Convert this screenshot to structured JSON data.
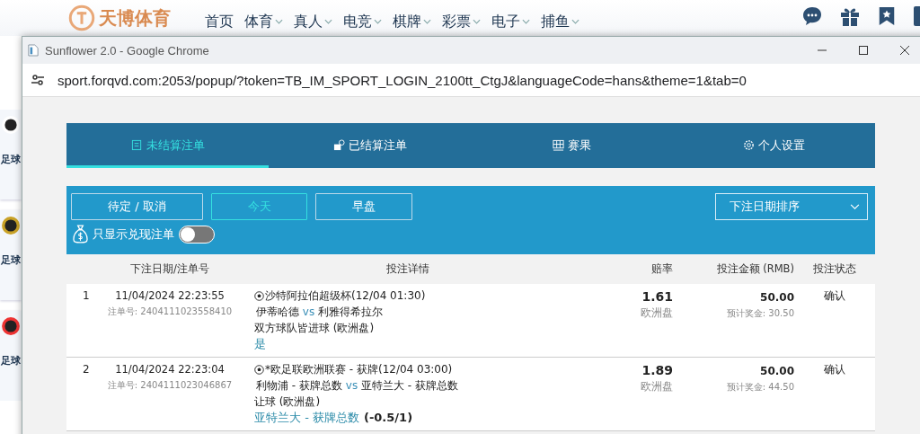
{
  "background_site": {
    "logo_text": "天博体育",
    "nav": [
      {
        "label": "首页",
        "dropdown": false
      },
      {
        "label": "体育",
        "dropdown": true
      },
      {
        "label": "真人",
        "dropdown": true
      },
      {
        "label": "电竞",
        "dropdown": true
      },
      {
        "label": "棋牌",
        "dropdown": true
      },
      {
        "label": "彩票",
        "dropdown": true
      },
      {
        "label": "电子",
        "dropdown": true
      },
      {
        "label": "捕鱼",
        "dropdown": true
      }
    ],
    "sidebar_cards": [
      {
        "title": "足球"
      },
      {
        "title": "足球"
      },
      {
        "title": "足球"
      }
    ]
  },
  "window": {
    "title": "Sunflower 2.0 - Google Chrome",
    "url": "sport.forqvd.com:2053/popup/?token=TB_IM_SPORT_LOGIN_2100tt_CtgJ&languageCode=hans&theme=1&tab=0"
  },
  "tabs": [
    {
      "label": "未结算注单",
      "kind": "unsettled",
      "selected": true
    },
    {
      "label": "已结算注单",
      "kind": "settled",
      "selected": false
    },
    {
      "label": "赛果",
      "kind": "results",
      "selected": false
    },
    {
      "label": "个人设置",
      "kind": "settings",
      "selected": false
    }
  ],
  "filters": [
    {
      "label": "待定 / 取消",
      "selected": false
    },
    {
      "label": "今天",
      "selected": true
    },
    {
      "label": "早盘",
      "selected": false
    }
  ],
  "sort": {
    "value": "下注日期排序"
  },
  "toggle": {
    "label": "只显示兑现注单",
    "on": false
  },
  "table": {
    "columns": [
      "下注日期/注单号",
      "投注详情",
      "赔率",
      "投注金额 (RMB)",
      "投注状态"
    ],
    "rows": [
      {
        "number": "1",
        "date": "11/04/2024 22:23:55",
        "ticket": "注单号: 2404111023558410",
        "league": "沙特阿拉伯超级杯(12/04 01:30)",
        "home": "伊蒂哈德",
        "vs": "vs",
        "away": "利雅得希拉尔",
        "market": "双方球队皆进球 (欧洲盘)",
        "selection": "是",
        "odds": "1.61",
        "odds_type": "欧洲盘",
        "stake": "50.00",
        "payout": "预计奖金: 30.50",
        "status": "确认"
      },
      {
        "number": "2",
        "date": "11/04/2024 22:23:04",
        "ticket": "注单号: 2404111023046867",
        "league": "*欧足联欧洲联赛 - 获牌(12/04 03:00)",
        "home": "利物浦 - 获牌总数",
        "vs": "vs",
        "away": "亚特兰大 - 获牌总数",
        "market": "让球 (欧洲盘)",
        "selection": "亚特兰大 - 获牌总数",
        "handicap": "(-0.5/1)",
        "odds": "1.89",
        "odds_type": "欧洲盘",
        "stake": "50.00",
        "payout": "预计奖金: 44.50",
        "status": "确认"
      }
    ]
  }
}
